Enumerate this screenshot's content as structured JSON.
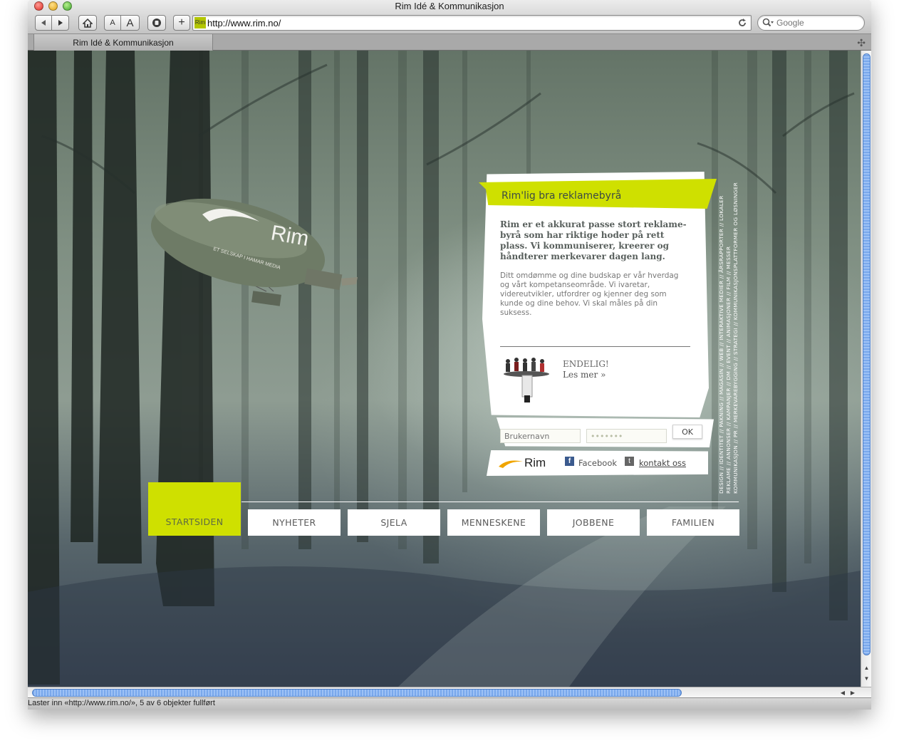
{
  "window": {
    "title": "Rim Idé & Kommunikasjon"
  },
  "toolbar": {
    "back_icon": "back-arrow-icon",
    "forward_icon": "forward-arrow-icon",
    "home_icon": "home-icon",
    "text_smaller_label": "A",
    "text_bigger_label": "A",
    "stop_icon": "stop-icon",
    "add_bookmark_label": "+",
    "favicon_text": "Rim",
    "url": "http://www.rim.no/",
    "reload_icon": "reload-icon",
    "search_placeholder": "Google"
  },
  "tabs": [
    {
      "label": "Rim Idé & Kommunikasjon"
    }
  ],
  "status": {
    "text": "Laster inn «http://www.rim.no/», 5 av 6 objekter fullført"
  },
  "blimp": {
    "logo_text": "Rim",
    "tagline": "ET SELSKAP I HAMAR MEDIA"
  },
  "card": {
    "title": "Rim'lig bra reklamebyrå",
    "intro": "Rim er et akkurat passe stort reklame-byrå som har riktige hoder på rett plass. Vi kommuniserer, kreerer og håndterer merkevarer dagen lang.",
    "body": "Ditt omdømme og dine budskap er vår hverdag og vårt kompetanseområde. Vi ivaretar, videreutvikler, utfordrer og kjenner deg som kunde og dine behov. Vi skal måles på din suksess.",
    "teaser_title": "ENDELIG!",
    "teaser_link": "Les mer »"
  },
  "login": {
    "username_placeholder": "Brukernavn",
    "password_value": "•••••••",
    "ok_label": "OK"
  },
  "footer": {
    "logo_text": "Rim",
    "facebook_label": "Facebook",
    "contact_label": "kontakt oss"
  },
  "services": {
    "line1": "DESIGN // IDENTITET // PAKNING // MAGASIN // WEB // INTERAKTIVE MEDIER // ÅRSRAPPORTER // LOKALER",
    "line2": "REKLAME // ANNONSER // KAMPANJER // DM // EVENT // ANIMASJONER // FILM // MESSER",
    "line3": "KOMMUNIKASJON // PR // MERKEVAREBYGGING // STRATEGI // KOMMUNIKASJONSPLATTFORMER OG LØSNINGER"
  },
  "nav": [
    {
      "label": "STARTSIDEN",
      "active": true
    },
    {
      "label": "NYHETER"
    },
    {
      "label": "SJELA"
    },
    {
      "label": "MENNESKENE"
    },
    {
      "label": "JOBBENE"
    },
    {
      "label": "FAMILIEN"
    }
  ],
  "colors": {
    "accent": "#cfe000",
    "card_bg": "#ffffff",
    "scroll_thumb": "#79a8ec"
  }
}
